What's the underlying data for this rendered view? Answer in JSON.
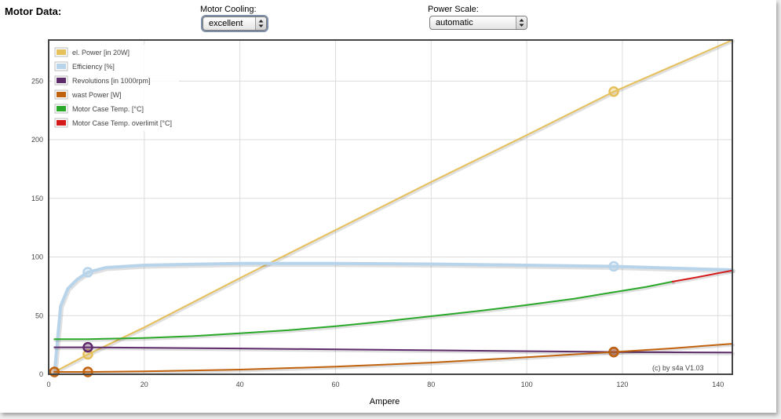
{
  "header": {
    "title": "Motor Data:",
    "cooling_label": "Motor Cooling:",
    "cooling_value": "excellent",
    "power_scale_label": "Power Scale:",
    "power_scale_value": "automatic"
  },
  "chart_data": {
    "type": "line",
    "xlabel": "Ampere",
    "ylabel": "",
    "xlim": [
      0,
      143
    ],
    "ylim": [
      0,
      285
    ],
    "xticks": [
      0,
      20,
      40,
      60,
      80,
      100,
      120,
      140
    ],
    "yticks": [
      0,
      50,
      100,
      150,
      200,
      250
    ],
    "grid": true,
    "legend_position": "top-left",
    "credit": "(c) by s4a    V1.03",
    "series": [
      {
        "name": "el. Power [in 20W]",
        "color": "#e6c05a",
        "x": [
          1.2,
          8.2,
          20,
          40,
          60,
          80,
          100,
          118.2,
          143
        ],
        "y": [
          2,
          17,
          40,
          82,
          123,
          164,
          204,
          241,
          285
        ],
        "markers": [
          [
            8.2,
            17
          ],
          [
            118.2,
            241
          ]
        ]
      },
      {
        "name": "Efficiency [%]",
        "color": "#b8d4ea",
        "x": [
          1.2,
          2.5,
          4,
          6,
          8.2,
          12,
          20,
          40,
          60,
          80,
          100,
          118.2,
          143
        ],
        "y": [
          0,
          58,
          73,
          81,
          87,
          91,
          93,
          94.5,
          94.5,
          94,
          93,
          92,
          89
        ],
        "markers": [
          [
            8.2,
            87
          ],
          [
            118.2,
            92
          ]
        ]
      },
      {
        "name": "Revolutions [in 1000rpm]",
        "color": "#5e2c6a",
        "x": [
          1.2,
          8.2,
          40,
          80,
          118.2,
          143
        ],
        "y": [
          23,
          23,
          22,
          20.5,
          19,
          18.5
        ],
        "markers": [
          [
            8.2,
            23
          ],
          [
            118.2,
            19
          ]
        ]
      },
      {
        "name": "wast Power [W]",
        "color": "#c0620e",
        "x": [
          1.2,
          8.2,
          20,
          40,
          60,
          80,
          100,
          118.2,
          130,
          143
        ],
        "y": [
          2,
          2,
          2.5,
          4,
          6.5,
          10,
          14.5,
          19,
          22,
          26
        ],
        "markers": [
          [
            1.2,
            2
          ],
          [
            8.2,
            2
          ],
          [
            118.2,
            19
          ]
        ]
      },
      {
        "name": "Motor Case Temp. [°C]",
        "color": "#2aa82a",
        "x": [
          1.2,
          8.2,
          20,
          30,
          40,
          50,
          60,
          70,
          80,
          90,
          100,
          110,
          118.2,
          125,
          130.5
        ],
        "y": [
          30,
          30,
          31,
          32.5,
          35,
          37.5,
          41,
          45,
          49.5,
          54,
          59,
          64.5,
          70,
          74.5,
          79
        ],
        "markers": []
      },
      {
        "name": "Motor Case Temp. overlimit [°C]",
        "color": "#d41a1a",
        "x": [
          130.5,
          136,
          143
        ],
        "y": [
          79,
          83,
          88.5
        ],
        "markers": []
      }
    ]
  }
}
